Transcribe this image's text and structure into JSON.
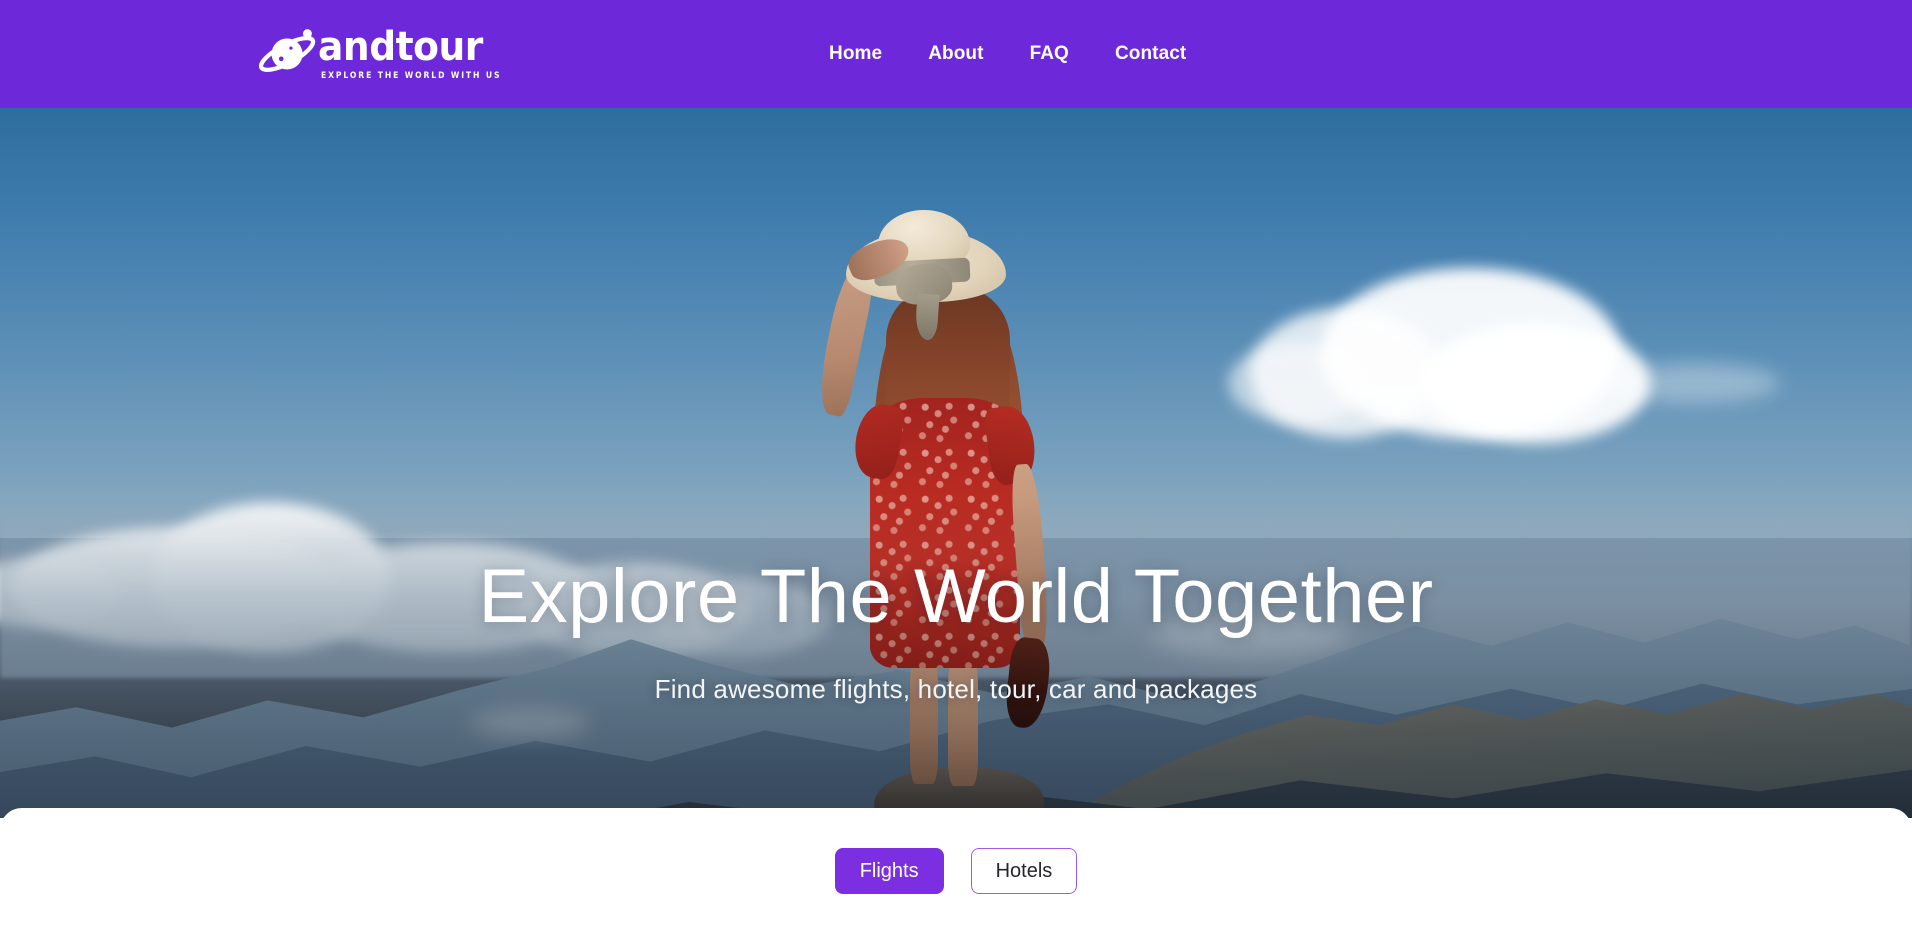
{
  "brand": {
    "icon": "saturn-planet-icon",
    "name": "andtour",
    "tagline": "EXPLORE THE WORLD WITH US"
  },
  "nav": {
    "items": [
      {
        "label": "Home"
      },
      {
        "label": "About"
      },
      {
        "label": "FAQ"
      },
      {
        "label": "Contact"
      }
    ]
  },
  "hero": {
    "title": "Explore The World Together",
    "subtitle": "Find awesome flights, hotel, tour, car and packages",
    "image_description": "Woman in red floral dress with straw sun hat standing on a rock overlooking layered blue mountains under a cloudy blue sky"
  },
  "search_card": {
    "tabs": [
      {
        "label": "Flights",
        "active": true
      },
      {
        "label": "Hotels",
        "active": false
      }
    ]
  },
  "colors": {
    "brand_purple": "#6C28D9",
    "accent_purple": "#7B2FE0",
    "tab_border": "#9F5BE8",
    "card_background": "#FFFFFF",
    "nav_text": "#FFFFFF",
    "hero_text": "#FFFFFF"
  }
}
